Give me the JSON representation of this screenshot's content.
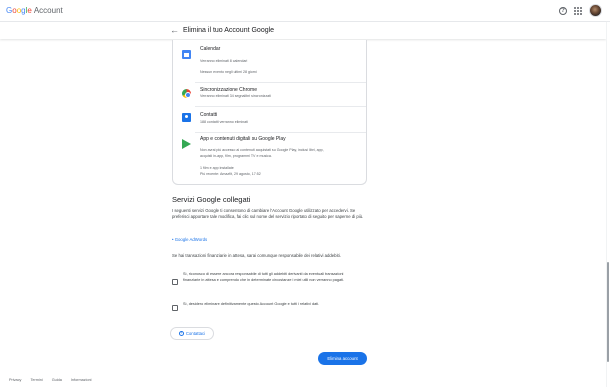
{
  "header": {
    "logo_text": "Google Account",
    "logo_letters": [
      "G",
      "o",
      "o",
      "g",
      "l",
      "e"
    ],
    "logo_suffix": "Account",
    "help_icon": "help-circle-icon",
    "apps_icon": "apps-grid-icon",
    "avatar": "user-avatar"
  },
  "page": {
    "back_icon": "arrow-back-icon",
    "title": "Elimina il tuo Account Google"
  },
  "services": [
    {
      "icon": "calendar-icon",
      "title": "Calendar",
      "lines": [
        "Verranno eliminati 8 calendari",
        "Nessun evento negli ultimi 28 giorni"
      ]
    },
    {
      "icon": "chrome-icon",
      "title": "Sincronizzazione Chrome",
      "lines": [
        "Verranno eliminati 34 segnalibri sincronizzati"
      ]
    },
    {
      "icon": "contacts-icon",
      "title": "Contatti",
      "lines": [
        "188 contatti verranno eliminati"
      ]
    },
    {
      "icon": "google-play-icon",
      "title": "App e contenuti digitali su Google Play",
      "lines": [
        "Non avrai più accesso ai contenuti acquistati su Google Play, inclusi libri, app,",
        "acquisti in-app, film, programmi TV e musica.",
        "",
        "1 film e app installate",
        "Più recente: Amazfit, 29 agosto, 17:52"
      ]
    }
  ],
  "linked": {
    "title": "Servizi Google collegati",
    "intro": "I seguenti servizi Google ti consentono di cambiare l'Account Google utilizzato per accedervi. Se preferisci apportare tale modifica, fai clic sul nome del servizio riportato di seguito per saperne di più.",
    "link": "• Google AdWords",
    "note": "Se hai transazioni finanziarie in attesa, sarai comunque responsabile dei relativi addebiti."
  },
  "checks": [
    "Sì, riconosco di essere ancora responsabile di tutti gli addebiti derivanti da eventuali transazioni finanziarie in attesa e comprendo che in determinate circostanze i miei utili non verranno pagati.",
    "Sì, desidero eliminare definitivamente questo Account Google e tutti i relativi dati."
  ],
  "buttons": {
    "contact_icon": "help-outline-icon",
    "contact_label": "Contattaci",
    "delete_label": "Elimina account"
  },
  "footer": [
    "Privacy",
    "Termini",
    "Guida",
    "Informazioni"
  ],
  "colors": {
    "accent": "#1a73e8",
    "text": "#202124",
    "secondary_text": "#5f6368",
    "border": "#dadce0"
  }
}
